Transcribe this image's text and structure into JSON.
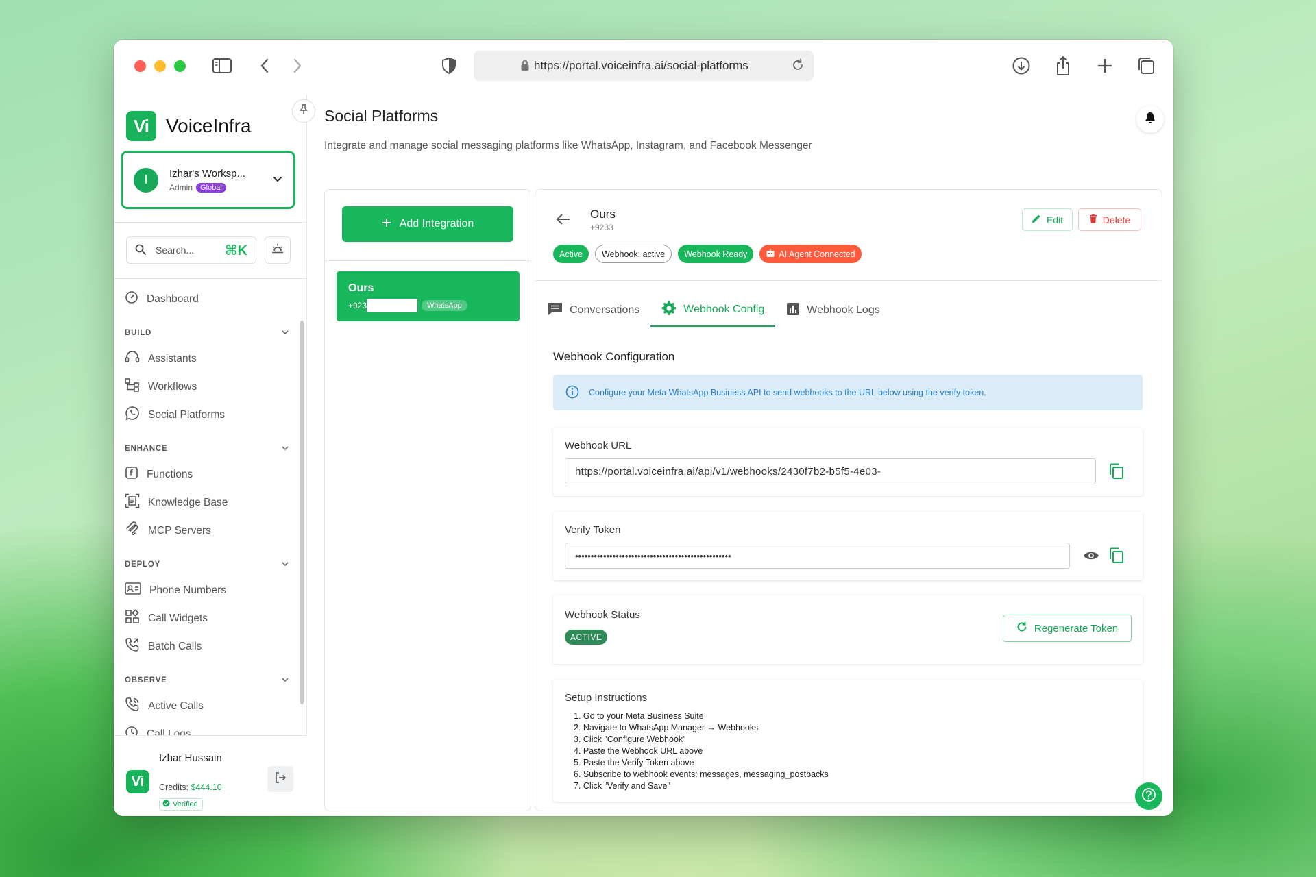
{
  "browser": {
    "url": "https://portal.voiceinfra.ai/social-platforms"
  },
  "brand": {
    "logo_glyph": "Vi",
    "name": "VoiceInfra",
    "accent": "#18b75c"
  },
  "workspace": {
    "initial": "I",
    "name": "Izhar's Worksp...",
    "role": "Admin",
    "scope": "Global"
  },
  "search": {
    "placeholder": "Search...",
    "shortcut": "⌘K"
  },
  "nav": {
    "dashboard": "Dashboard",
    "build_title": "BUILD",
    "assistants": "Assistants",
    "workflows": "Workflows",
    "social_platforms": "Social Platforms",
    "enhance_title": "ENHANCE",
    "functions": "Functions",
    "knowledge_base": "Knowledge Base",
    "mcp_servers": "MCP Servers",
    "deploy_title": "DEPLOY",
    "phone_numbers": "Phone Numbers",
    "call_widgets": "Call Widgets",
    "batch_calls": "Batch Calls",
    "observe_title": "OBSERVE",
    "active_calls": "Active Calls",
    "call_logs": "Call Logs"
  },
  "user": {
    "name": "Izhar Hussain",
    "credits_label": "Credits:",
    "credits_value": "$444.10",
    "verified": "Verified"
  },
  "page": {
    "title": "Social Platforms",
    "subtitle": "Integrate and manage social messaging platforms like WhatsApp, Instagram, and Facebook Messenger"
  },
  "integrations": {
    "add_label": "Add Integration",
    "items": [
      {
        "name": "Ours",
        "phone_prefix": "+923",
        "platform": "WhatsApp"
      }
    ]
  },
  "detail": {
    "name": "Ours",
    "phone": "+9233",
    "edit_label": "Edit",
    "delete_label": "Delete",
    "chips": [
      "Active",
      "Webhook: active",
      "Webhook Ready",
      "AI Agent Connected"
    ],
    "tabs": [
      "Conversations",
      "Webhook Config",
      "Webhook Logs"
    ],
    "active_tab": "Webhook Config"
  },
  "webhook": {
    "section_title": "Webhook Configuration",
    "info": "Configure your Meta WhatsApp Business API to send webhooks to the URL below using the verify token.",
    "url_label": "Webhook URL",
    "url_value": "https://portal.voiceinfra.ai/api/v1/webhooks/2430f7b2-b5f5-4e03-",
    "token_label": "Verify Token",
    "token_value": "••••••••••••••••••••••••••••••••••••••••••••••••••",
    "status_label": "Webhook Status",
    "status_value": "ACTIVE",
    "regen_label": "Regenerate Token",
    "setup_title": "Setup Instructions",
    "steps": [
      "1. Go to your Meta Business Suite",
      "2. Navigate to WhatsApp Manager → Webhooks",
      "3. Click \"Configure Webhook\"",
      "4. Paste the Webhook URL above",
      "5. Paste the Verify Token above",
      "6. Subscribe to webhook events: messages, messaging_postbacks",
      "7. Click \"Verify and Save\""
    ]
  }
}
